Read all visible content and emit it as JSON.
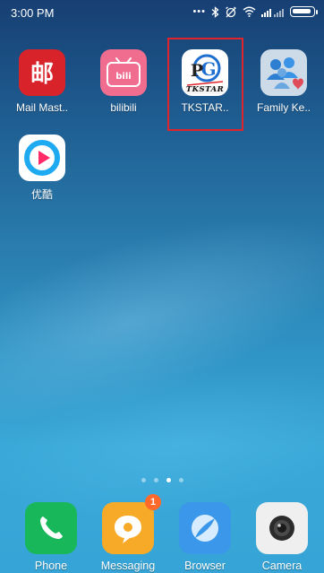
{
  "status_bar": {
    "time": "3:00 PM",
    "icons": [
      "more-dots-icon",
      "bluetooth-icon",
      "alarm-off-icon",
      "wifi-icon",
      "signal-icon",
      "battery-icon"
    ]
  },
  "home_apps": [
    {
      "name": "mail-master",
      "label": "Mail Mast..",
      "icon": "mail-master-icon",
      "color": "#d9232b"
    },
    {
      "name": "bilibili",
      "label": "bilibili",
      "icon": "bilibili-icon",
      "color": "#f26b8a"
    },
    {
      "name": "tkstar",
      "label": "TKSTAR..",
      "icon": "tkstar-icon",
      "color": "#ffffff",
      "logo_text": "TKSTAR"
    },
    {
      "name": "family-keeper",
      "label": "Family Ke..",
      "icon": "family-keeper-icon",
      "color": "#c9d9ea"
    },
    {
      "name": "youku",
      "label": "优酷",
      "icon": "youku-icon",
      "color": "#ffffff"
    }
  ],
  "highlighted_app": "tkstar",
  "page_indicator": {
    "count": 4,
    "active": 3
  },
  "dock": [
    {
      "name": "phone",
      "label": "Phone",
      "icon": "phone-icon",
      "color": "#18b85a"
    },
    {
      "name": "messaging",
      "label": "Messaging",
      "icon": "message-icon",
      "color": "#f7a928",
      "badge": "1"
    },
    {
      "name": "browser",
      "label": "Browser",
      "icon": "browser-icon",
      "color": "#3a97ea"
    },
    {
      "name": "camera",
      "label": "Camera",
      "icon": "camera-icon",
      "color": "#f2f2f2"
    }
  ]
}
